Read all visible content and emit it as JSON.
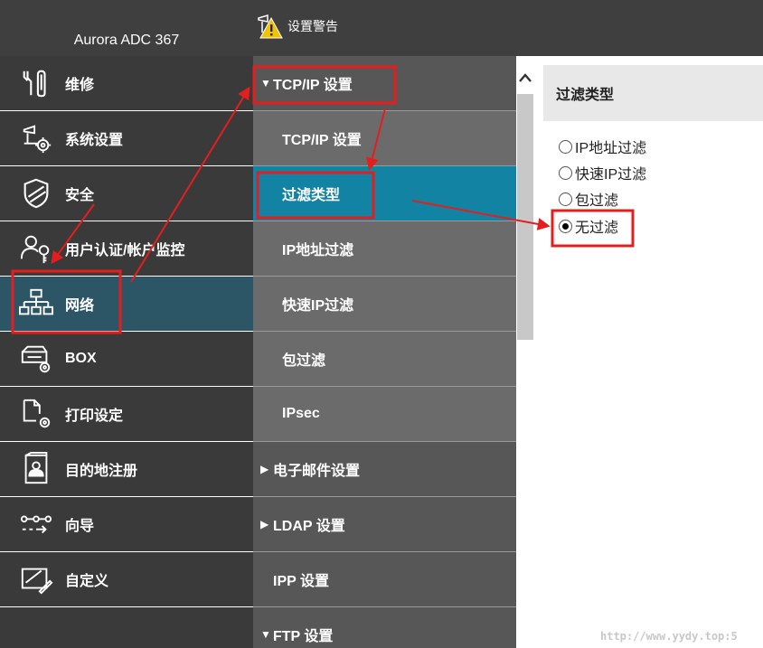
{
  "header": {
    "device_name": "Aurora ADC 367",
    "alert_label": "设置警告",
    "alert_icon": "warning-icon"
  },
  "left_nav": {
    "items": [
      {
        "label": "维修",
        "icon": "maintenance-icon"
      },
      {
        "label": "系统设置",
        "icon": "system-settings-icon"
      },
      {
        "label": "安全",
        "icon": "shield-icon"
      },
      {
        "label": "用户认证/帐户监控",
        "icon": "user-key-icon"
      },
      {
        "label": "网络",
        "icon": "network-icon",
        "active": true
      },
      {
        "label": "BOX",
        "icon": "box-icon"
      },
      {
        "label": "打印设定",
        "icon": "print-settings-icon"
      },
      {
        "label": "目的地注册",
        "icon": "address-book-icon"
      },
      {
        "label": "向导",
        "icon": "wizard-icon"
      },
      {
        "label": "自定义",
        "icon": "customize-icon"
      }
    ]
  },
  "mid_nav": {
    "items": [
      {
        "label": "TCP/IP 设置",
        "type": "group",
        "expanded": true
      },
      {
        "label": "TCP/IP 设置",
        "type": "sub"
      },
      {
        "label": "过滤类型",
        "type": "sub",
        "active": true
      },
      {
        "label": "IP地址过滤",
        "type": "sub"
      },
      {
        "label": "快速IP过滤",
        "type": "sub"
      },
      {
        "label": "包过滤",
        "type": "sub"
      },
      {
        "label": "IPsec",
        "type": "sub"
      },
      {
        "label": "电子邮件设置",
        "type": "group",
        "expanded": false
      },
      {
        "label": "LDAP 设置",
        "type": "group",
        "expanded": false
      },
      {
        "label": "IPP 设置",
        "type": "group",
        "expanded": null
      },
      {
        "label": "FTP 设置",
        "type": "group",
        "expanded": true
      }
    ]
  },
  "panel": {
    "title": "过滤类型",
    "options": [
      {
        "label": "IP地址过滤",
        "checked": false
      },
      {
        "label": "快速IP过滤",
        "checked": false
      },
      {
        "label": "包过滤",
        "checked": false
      },
      {
        "label": "无过滤",
        "checked": true
      }
    ]
  },
  "colors": {
    "header_bg": "#3f3f3f",
    "nav_bg": "#3a3a3a",
    "nav_active": "#2c5566",
    "mid_bg": "#6b6b6b",
    "mid_group": "#575757",
    "mid_active": "#1283a3",
    "annotation": "#e41e1e"
  },
  "watermark": "http://www.yydy.top:5"
}
